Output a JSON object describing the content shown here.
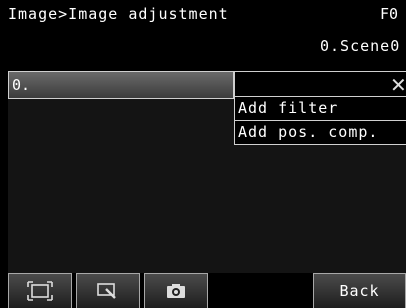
{
  "header": {
    "breadcrumb": "Image>Image adjustment",
    "right_text": "F0",
    "scene": "0.Scene0"
  },
  "item_bar": {
    "label": "0."
  },
  "close_icon": "close-icon",
  "menu": {
    "items": [
      {
        "label": "Add filter"
      },
      {
        "label": "Add pos. comp."
      }
    ]
  },
  "toolbar": {
    "icons": [
      "frame-icon",
      "zoom-icon",
      "camera-icon"
    ],
    "back_label": "Back"
  }
}
